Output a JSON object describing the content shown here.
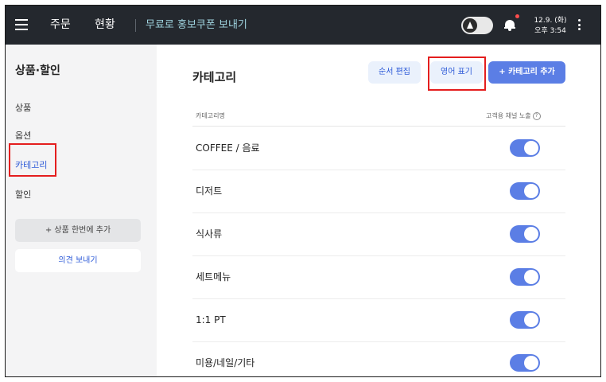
{
  "topbar": {
    "nav": [
      "주문",
      "현황"
    ],
    "promo_link": "무료로 홍보쿠폰 보내기",
    "date": "12.9. (화)",
    "time": "오후 3:54"
  },
  "sidebar": {
    "title": "상품·할인",
    "items": [
      {
        "label": "상품",
        "active": false
      },
      {
        "label": "옵션",
        "active": false
      },
      {
        "label": "카테고리",
        "active": true
      },
      {
        "label": "할인",
        "active": false
      }
    ],
    "bulk_add_button": "+ 상품 한번에 추가",
    "feedback_button": "의견 보내기"
  },
  "main": {
    "title": "카테고리",
    "buttons": {
      "reorder": "순서 편집",
      "english": "영어 표기",
      "add_category": "+ 카테고리 추가"
    },
    "columns": {
      "name": "카테고리명",
      "channel": "고객용 채널 노출"
    },
    "rows": [
      {
        "name": "COFFEE / 음료",
        "exposed": true
      },
      {
        "name": "디저트",
        "exposed": true
      },
      {
        "name": "식사류",
        "exposed": true
      },
      {
        "name": "세트메뉴",
        "exposed": true
      },
      {
        "name": "1:1 PT",
        "exposed": true
      },
      {
        "name": "미용/네일/기타",
        "exposed": true
      }
    ]
  },
  "colors": {
    "accent": "#5b7ee5",
    "topbar": "#24282e",
    "highlight": "#e41e1e"
  }
}
